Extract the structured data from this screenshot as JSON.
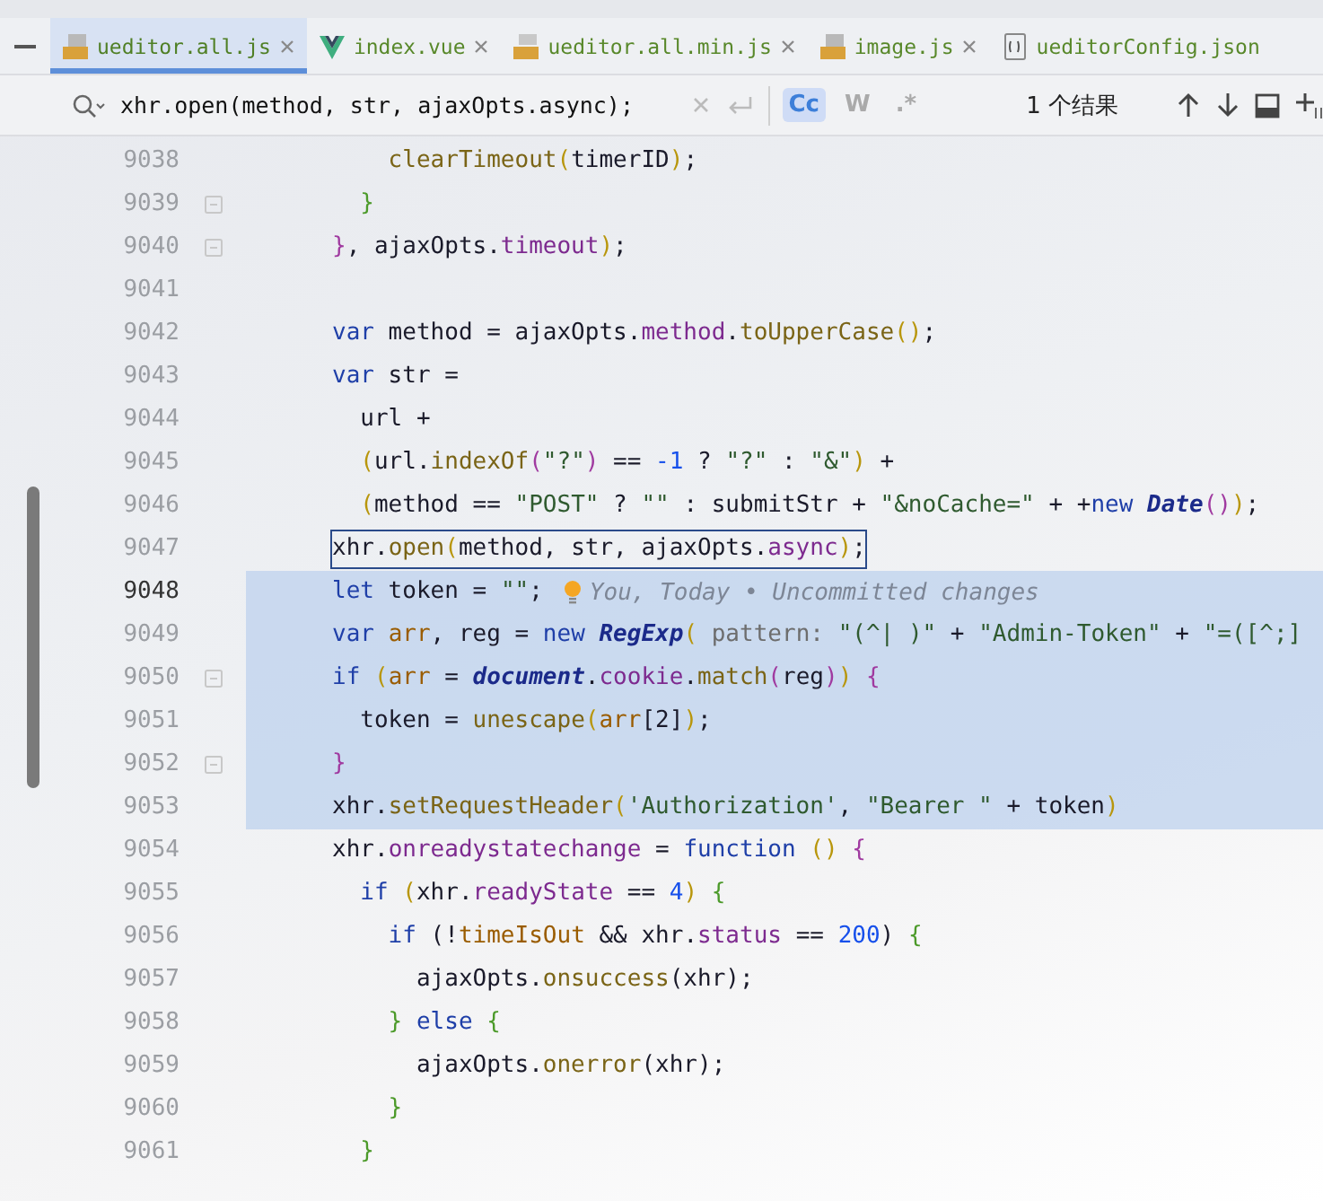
{
  "tabs": [
    {
      "label": "ueditor.all.js",
      "kind": "js",
      "selected": true,
      "close": true
    },
    {
      "label": "index.vue",
      "kind": "vue",
      "selected": false,
      "close": true
    },
    {
      "label": "ueditor.all.min.js",
      "kind": "minjs",
      "selected": false,
      "close": true
    },
    {
      "label": "image.js",
      "kind": "js",
      "selected": false,
      "close": true
    },
    {
      "label": "ueditorConfig.json",
      "kind": "json",
      "selected": false,
      "close": false
    }
  ],
  "find": {
    "value": "xhr.open(method, str, ajaxOpts.async);",
    "toggles": [
      {
        "label": "Cc",
        "selected": true
      },
      {
        "label": "W",
        "selected": false
      },
      {
        "label": ".*",
        "selected": false
      }
    ],
    "result": "1 个结果"
  },
  "lines": [
    {
      "number": "9038",
      "selected": false,
      "current": false,
      "match": false,
      "fold": false,
      "code": [
        {
          "text": "    clearTimeout",
          "kind": "fn"
        },
        {
          "text": "(",
          "kind": "p1"
        },
        {
          "text": "timerID",
          "kind": "plain"
        },
        {
          "text": ")",
          "kind": "p1"
        },
        {
          "text": ";",
          "kind": "plain"
        }
      ]
    },
    {
      "number": "9039",
      "selected": false,
      "current": false,
      "match": false,
      "fold": true,
      "code": [
        {
          "text": "  }",
          "kind": "p3"
        }
      ]
    },
    {
      "number": "9040",
      "selected": false,
      "current": false,
      "match": false,
      "fold": true,
      "code": [
        {
          "text": "}",
          "kind": "p2"
        },
        {
          "text": ", ajaxOpts.",
          "kind": "plain"
        },
        {
          "text": "timeout",
          "kind": "prop"
        },
        {
          "text": ")",
          "kind": "p1"
        },
        {
          "text": ";",
          "kind": "plain"
        }
      ]
    },
    {
      "number": "9041",
      "selected": false,
      "current": false,
      "match": false,
      "fold": false
    },
    {
      "number": "9042",
      "selected": false,
      "current": false,
      "match": false,
      "fold": false,
      "code": [
        {
          "text": "var",
          "kind": "kw"
        },
        {
          "text": " method = ajaxOpts.",
          "kind": "plain"
        },
        {
          "text": "method",
          "kind": "prop"
        },
        {
          "text": ".",
          "kind": "plain"
        },
        {
          "text": "toUpperCase",
          "kind": "fn"
        },
        {
          "text": "()",
          "kind": "p1"
        },
        {
          "text": ";",
          "kind": "plain"
        }
      ]
    },
    {
      "number": "9043",
      "selected": false,
      "current": false,
      "match": false,
      "fold": false,
      "code": [
        {
          "text": "var",
          "kind": "kw"
        },
        {
          "text": " str =",
          "kind": "plain"
        }
      ]
    },
    {
      "number": "9044",
      "selected": false,
      "current": false,
      "match": false,
      "fold": false,
      "code": [
        {
          "text": "  url +",
          "kind": "plain"
        }
      ]
    },
    {
      "number": "9045",
      "selected": false,
      "current": false,
      "match": false,
      "fold": false,
      "code": [
        {
          "text": "  (",
          "kind": "p1"
        },
        {
          "text": "url.",
          "kind": "plain"
        },
        {
          "text": "indexOf",
          "kind": "fn"
        },
        {
          "text": "(",
          "kind": "p2"
        },
        {
          "text": "\"?\"",
          "kind": "str"
        },
        {
          "text": ")",
          "kind": "p2"
        },
        {
          "text": " == ",
          "kind": "plain"
        },
        {
          "text": "-1",
          "kind": "num"
        },
        {
          "text": " ? ",
          "kind": "plain"
        },
        {
          "text": "\"?\"",
          "kind": "str"
        },
        {
          "text": " : ",
          "kind": "plain"
        },
        {
          "text": "\"&\"",
          "kind": "str"
        },
        {
          "text": ")",
          "kind": "p1"
        },
        {
          "text": " +",
          "kind": "plain"
        }
      ]
    },
    {
      "number": "9046",
      "selected": false,
      "current": false,
      "match": false,
      "fold": false,
      "code": [
        {
          "text": "  (",
          "kind": "p1"
        },
        {
          "text": "method == ",
          "kind": "plain"
        },
        {
          "text": "\"POST\"",
          "kind": "str"
        },
        {
          "text": " ? ",
          "kind": "plain"
        },
        {
          "text": "\"\"",
          "kind": "str"
        },
        {
          "text": " : submitStr + ",
          "kind": "plain"
        },
        {
          "text": "\"&noCache=\"",
          "kind": "str"
        },
        {
          "text": " + +",
          "kind": "plain"
        },
        {
          "text": "new ",
          "kind": "kw"
        },
        {
          "text": "Date",
          "kind": "global"
        },
        {
          "text": "()",
          "kind": "p2"
        },
        {
          "text": ")",
          "kind": "p1"
        },
        {
          "text": ";",
          "kind": "plain"
        }
      ]
    },
    {
      "number": "9047",
      "selected": false,
      "current": false,
      "match": true,
      "fold": false,
      "code": [
        {
          "text": "xhr.",
          "kind": "plain"
        },
        {
          "text": "open",
          "kind": "fn"
        },
        {
          "text": "(",
          "kind": "p1"
        },
        {
          "text": "method, str, ajaxOpts.",
          "kind": "plain"
        },
        {
          "text": "async",
          "kind": "prop"
        },
        {
          "text": ")",
          "kind": "p1"
        },
        {
          "text": ";",
          "kind": "plain"
        }
      ]
    },
    {
      "number": "9048",
      "selected": true,
      "current": true,
      "match": false,
      "fold": false,
      "blame": "You, Today • Uncommitted changes",
      "code": [
        {
          "text": "let",
          "kind": "kw"
        },
        {
          "text": " token = ",
          "kind": "plain"
        },
        {
          "text": "\"\"",
          "kind": "str"
        },
        {
          "text": ";",
          "kind": "plain"
        }
      ]
    },
    {
      "number": "9049",
      "selected": true,
      "current": false,
      "match": false,
      "fold": false,
      "code": [
        {
          "text": "var ",
          "kind": "kw"
        },
        {
          "text": "arr",
          "kind": "local"
        },
        {
          "text": ", reg = ",
          "kind": "plain"
        },
        {
          "text": "new ",
          "kind": "kw"
        },
        {
          "text": "RegExp",
          "kind": "global"
        },
        {
          "text": "(",
          "kind": "p1"
        },
        {
          "text": " pattern: ",
          "kind": "hint"
        },
        {
          "text": "\"(^| )\"",
          "kind": "str"
        },
        {
          "text": " + ",
          "kind": "plain"
        },
        {
          "text": "\"Admin-Token\"",
          "kind": "str"
        },
        {
          "text": " + ",
          "kind": "plain"
        },
        {
          "text": "\"=([^;]",
          "kind": "str"
        }
      ]
    },
    {
      "number": "9050",
      "selected": true,
      "current": false,
      "match": false,
      "fold": true,
      "code": [
        {
          "text": "if ",
          "kind": "kw"
        },
        {
          "text": "(",
          "kind": "p1"
        },
        {
          "text": "arr",
          "kind": "local"
        },
        {
          "text": " = ",
          "kind": "plain"
        },
        {
          "text": "document",
          "kind": "global"
        },
        {
          "text": ".",
          "kind": "plain"
        },
        {
          "text": "cookie",
          "kind": "prop"
        },
        {
          "text": ".",
          "kind": "plain"
        },
        {
          "text": "match",
          "kind": "fn"
        },
        {
          "text": "(",
          "kind": "p2"
        },
        {
          "text": "reg",
          "kind": "plain"
        },
        {
          "text": ")",
          "kind": "p2"
        },
        {
          "text": ")",
          "kind": "p1"
        },
        {
          "text": " {",
          "kind": "p2"
        }
      ]
    },
    {
      "number": "9051",
      "selected": true,
      "current": false,
      "match": false,
      "fold": false,
      "code": [
        {
          "text": "  token = ",
          "kind": "plain"
        },
        {
          "text": "unescape",
          "kind": "fn"
        },
        {
          "text": "(",
          "kind": "p1"
        },
        {
          "text": "arr",
          "kind": "local"
        },
        {
          "text": "[2]",
          "kind": "plain"
        },
        {
          "text": ")",
          "kind": "p1"
        },
        {
          "text": ";",
          "kind": "plain"
        }
      ]
    },
    {
      "number": "9052",
      "selected": true,
      "current": false,
      "match": false,
      "fold": true,
      "code": [
        {
          "text": "}",
          "kind": "p2"
        }
      ]
    },
    {
      "number": "9053",
      "selected": true,
      "current": false,
      "match": false,
      "fold": false,
      "code": [
        {
          "text": "xhr.",
          "kind": "plain"
        },
        {
          "text": "setRequestHeader",
          "kind": "fn"
        },
        {
          "text": "(",
          "kind": "p1"
        },
        {
          "text": "'Authorization'",
          "kind": "str"
        },
        {
          "text": ", ",
          "kind": "plain"
        },
        {
          "text": "\"Bearer \"",
          "kind": "str"
        },
        {
          "text": " + token",
          "kind": "plain"
        },
        {
          "text": ")",
          "kind": "p1"
        }
      ]
    },
    {
      "number": "9054",
      "selected": false,
      "current": false,
      "match": false,
      "fold": false,
      "code": [
        {
          "text": "xhr.",
          "kind": "plain"
        },
        {
          "text": "onreadystatechange",
          "kind": "prop"
        },
        {
          "text": " = ",
          "kind": "plain"
        },
        {
          "text": "function ",
          "kind": "kw"
        },
        {
          "text": "()",
          "kind": "p1"
        },
        {
          "text": " {",
          "kind": "p2"
        }
      ]
    },
    {
      "number": "9055",
      "selected": false,
      "current": false,
      "match": false,
      "fold": false,
      "code": [
        {
          "text": "  if ",
          "kind": "kw"
        },
        {
          "text": "(",
          "kind": "p1"
        },
        {
          "text": "xhr.",
          "kind": "plain"
        },
        {
          "text": "readyState",
          "kind": "prop"
        },
        {
          "text": " == ",
          "kind": "plain"
        },
        {
          "text": "4",
          "kind": "num"
        },
        {
          "text": ")",
          "kind": "p1"
        },
        {
          "text": " {",
          "kind": "p3"
        }
      ]
    },
    {
      "number": "9056",
      "selected": false,
      "current": false,
      "match": false,
      "fold": false,
      "code": [
        {
          "text": "    if",
          "kind": "kw"
        },
        {
          "text": " (!",
          "kind": "plain"
        },
        {
          "text": "timeIsOut",
          "kind": "local"
        },
        {
          "text": " && xhr.",
          "kind": "plain"
        },
        {
          "text": "status",
          "kind": "prop"
        },
        {
          "text": " == ",
          "kind": "plain"
        },
        {
          "text": "200",
          "kind": "num"
        },
        {
          "text": ") ",
          "kind": "plain"
        },
        {
          "text": "{",
          "kind": "p3"
        }
      ]
    },
    {
      "number": "9057",
      "selected": false,
      "current": false,
      "match": false,
      "fold": false,
      "code": [
        {
          "text": "      ajaxOpts.",
          "kind": "plain"
        },
        {
          "text": "onsuccess",
          "kind": "fn"
        },
        {
          "text": "(xhr);",
          "kind": "plain"
        }
      ]
    },
    {
      "number": "9058",
      "selected": false,
      "current": false,
      "match": false,
      "fold": false,
      "code": [
        {
          "text": "    }",
          "kind": "p3"
        },
        {
          "text": " else ",
          "kind": "kw"
        },
        {
          "text": "{",
          "kind": "p3"
        }
      ]
    },
    {
      "number": "9059",
      "selected": false,
      "current": false,
      "match": false,
      "fold": false,
      "code": [
        {
          "text": "      ajaxOpts.",
          "kind": "plain"
        },
        {
          "text": "onerror",
          "kind": "fn"
        },
        {
          "text": "(xhr);",
          "kind": "plain"
        }
      ]
    },
    {
      "number": "9060",
      "selected": false,
      "current": false,
      "match": false,
      "fold": false,
      "code": [
        {
          "text": "    }",
          "kind": "p3"
        }
      ]
    },
    {
      "number": "9061",
      "selected": false,
      "current": false,
      "match": false,
      "fold": false,
      "code": [
        {
          "text": "  }",
          "kind": "p3"
        }
      ]
    }
  ]
}
